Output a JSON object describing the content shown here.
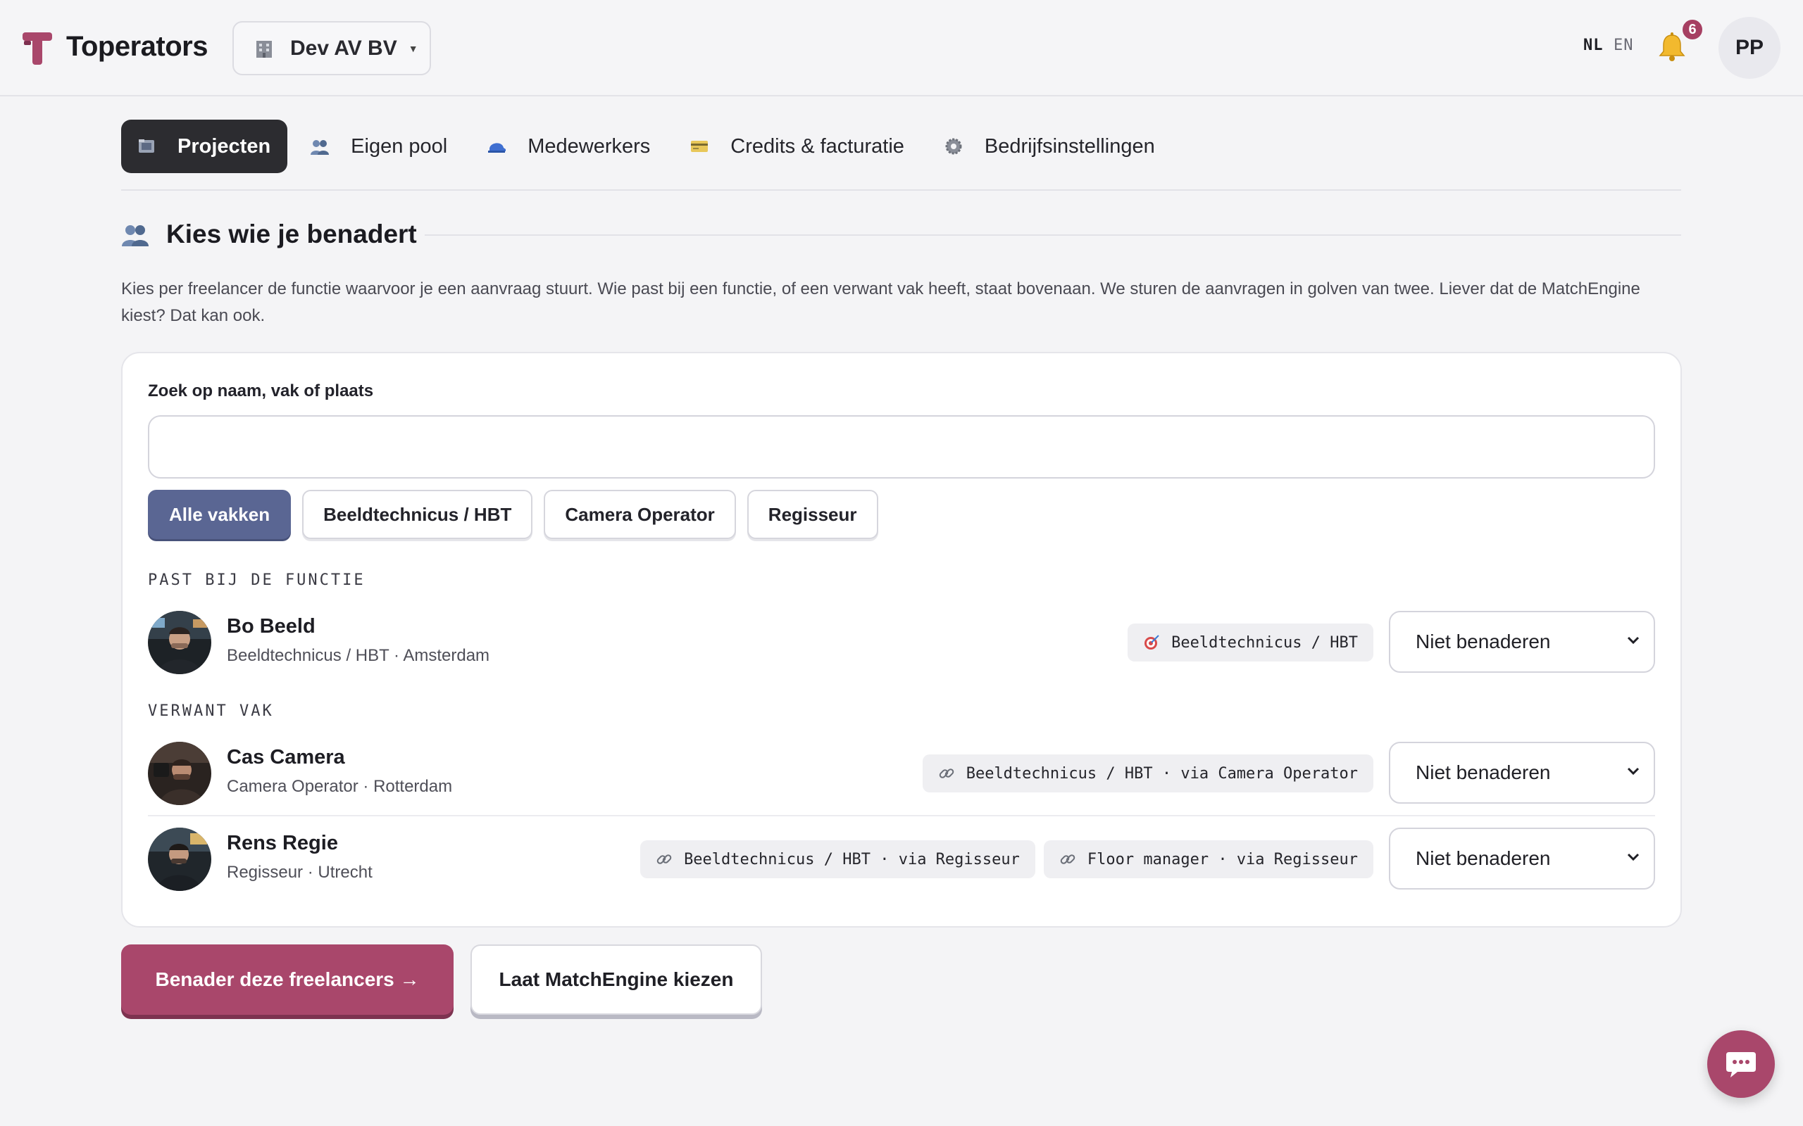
{
  "brand": {
    "name": "Toperators",
    "accent": "#a9476b"
  },
  "org": {
    "name": "Dev AV BV"
  },
  "lang": {
    "nl": "NL",
    "en": "EN",
    "active": "NL"
  },
  "notifications": {
    "count": "6"
  },
  "user": {
    "initials": "PP"
  },
  "nav": {
    "tabs": [
      {
        "label": "Projecten",
        "icon": "film-icon",
        "active": true
      },
      {
        "label": "Eigen pool",
        "icon": "people-icon"
      },
      {
        "label": "Medewerkers",
        "icon": "cap-icon"
      },
      {
        "label": "Credits & facturatie",
        "icon": "credit-card-icon"
      },
      {
        "label": "Bedrijfsinstellingen",
        "icon": "gear-icon"
      }
    ]
  },
  "section": {
    "title": "Kies wie je benadert",
    "intro": "Kies per freelancer de functie waarvoor je een aanvraag stuurt. Wie past bij een functie, of een verwant vak heeft, staat bovenaan. We sturen de aanvragen in golven van twee. Liever dat de MatchEngine kiest? Dat kan ook."
  },
  "search": {
    "label": "Zoek op naam, vak of plaats",
    "value": "",
    "placeholder": ""
  },
  "filters": [
    {
      "label": "Alle vakken",
      "active": true
    },
    {
      "label": "Beeldtechnicus / HBT"
    },
    {
      "label": "Camera Operator"
    },
    {
      "label": "Regisseur"
    }
  ],
  "groups": {
    "match": "PAST BIJ DE FUNCTIE",
    "related": "VERWANT VAK"
  },
  "freelancers": [
    {
      "name": "Bo Beeld",
      "meta": "Beeldtechnicus / HBT · Amsterdam",
      "tags": [
        {
          "icon": "target-icon",
          "text": "Beeldtechnicus / HBT"
        }
      ],
      "select": "Niet benaderen"
    },
    {
      "name": "Cas Camera",
      "meta": "Camera Operator · Rotterdam",
      "tags": [
        {
          "icon": "link-icon",
          "text": "Beeldtechnicus / HBT · via Camera Operator"
        }
      ],
      "select": "Niet benaderen"
    },
    {
      "name": "Rens Regie",
      "meta": "Regisseur · Utrecht",
      "tags": [
        {
          "icon": "link-icon",
          "text": "Beeldtechnicus / HBT · via Regisseur"
        },
        {
          "icon": "link-icon",
          "text": "Floor manager · via Regisseur"
        }
      ],
      "select": "Niet benaderen"
    }
  ],
  "actions": {
    "primary": "Benader deze freelancers →",
    "secondary": "Laat MatchEngine kiezen"
  }
}
